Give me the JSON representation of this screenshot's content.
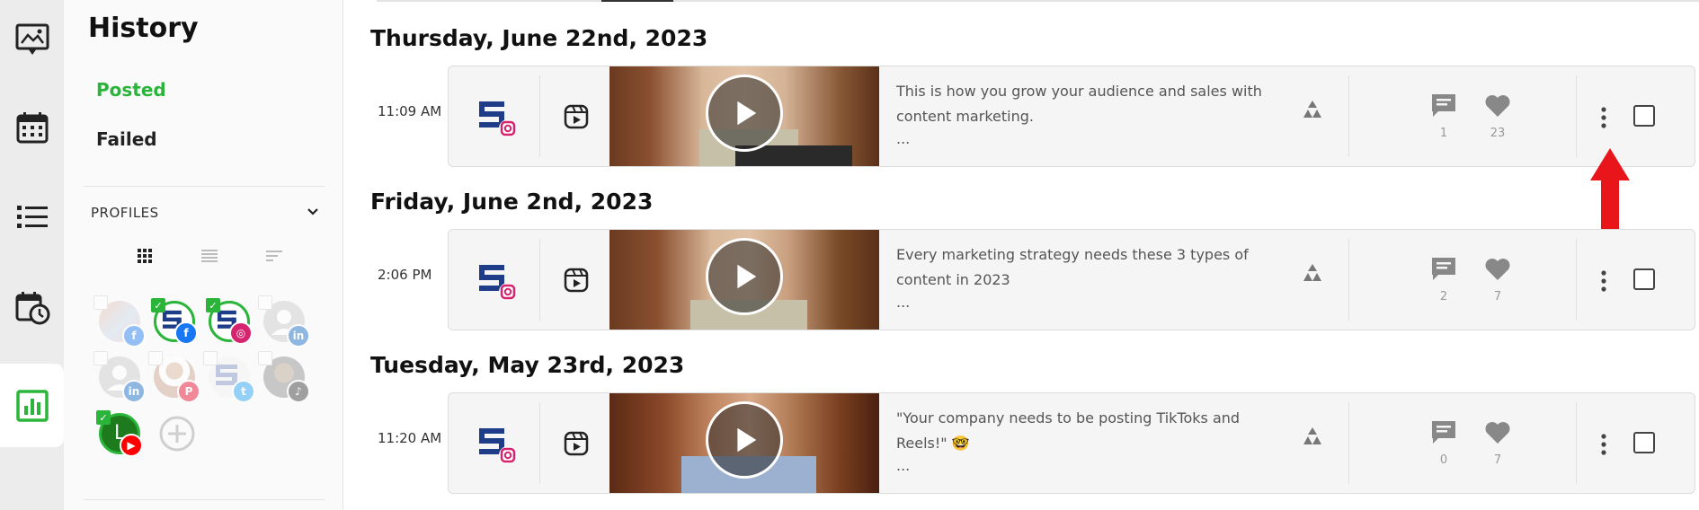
{
  "rail": {
    "items": [
      {
        "icon": "image-message-icon"
      },
      {
        "icon": "calendar-icon"
      },
      {
        "icon": "list-icon"
      },
      {
        "icon": "calendar-clock-icon"
      },
      {
        "icon": "analytics-icon",
        "active": true
      }
    ]
  },
  "sidebar": {
    "title": "History",
    "tabs": [
      {
        "label": "Posted",
        "active": true
      },
      {
        "label": "Failed",
        "active": false
      }
    ],
    "profiles_header": "PROFILES",
    "profiles": [
      {
        "label": "",
        "network": "facebook",
        "checked": false,
        "faded": true
      },
      {
        "label": "",
        "network": "facebook",
        "checked": true,
        "faded": false
      },
      {
        "label": "",
        "network": "instagram",
        "checked": true,
        "faded": false
      },
      {
        "label": "",
        "network": "linkedin",
        "checked": false,
        "faded": true
      },
      {
        "label": "",
        "network": "linkedin",
        "checked": false,
        "faded": true
      },
      {
        "label": "",
        "network": "pinterest",
        "checked": false,
        "faded": true
      },
      {
        "label": "",
        "network": "twitter",
        "checked": false,
        "faded": true
      },
      {
        "label": "",
        "network": "tiktok",
        "checked": false,
        "faded": true
      },
      {
        "label": "L",
        "network": "youtube",
        "checked": true,
        "faded": false
      }
    ]
  },
  "colors": {
    "accent": "#2ab53a",
    "instagram": "#d6246e",
    "facebook": "#1877f2",
    "linkedin": "#0a66c2",
    "pinterest": "#e60023",
    "twitter": "#1da1f2",
    "youtube": "#ff0000",
    "arrow": "#e8161b"
  },
  "feed": [
    {
      "date": "Thursday, June 22nd, 2023",
      "posts": [
        {
          "time": "11:09 AM",
          "caption_line1": "This is how you grow your audience and sales with",
          "caption_line2": "content marketing.",
          "ellipsis": "...",
          "comments": "1",
          "likes": "23"
        }
      ]
    },
    {
      "date": "Friday, June 2nd, 2023",
      "posts": [
        {
          "time": "2:06 PM",
          "caption_line1": "Every marketing strategy needs these 3 types of",
          "caption_line2": "content in 2023",
          "ellipsis": "...",
          "comments": "2",
          "likes": "7"
        }
      ]
    },
    {
      "date": "Tuesday, May 23rd, 2023",
      "posts": [
        {
          "time": "11:20 AM",
          "caption_line1": "\"Your company needs to be posting TikToks and",
          "caption_line2": "Reels!\" 🤓",
          "ellipsis": "...",
          "comments": "0",
          "likes": "7"
        }
      ]
    }
  ]
}
